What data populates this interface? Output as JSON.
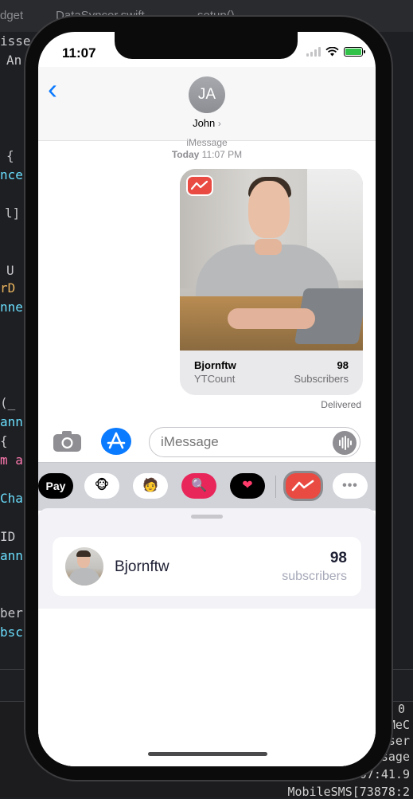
{
  "background": {
    "top_breadcrumb": [
      "dget",
      "DataSyncer.swift",
      "setup()"
    ],
    "code_fragments": [
      "isse",
      "An",
      "{",
      "nce",
      "l]",
      "U",
      "rD",
      "nne",
      "(_",
      "ann",
      "{",
      "m a",
      "Cha",
      "ID",
      "ann",
      "ber",
      "bsc"
    ],
    "console_lines": [
      "0",
      "MeC",
      "ser",
      "sage",
      "07:41.9",
      "MobileSMS[73878:2"
    ]
  },
  "status_bar": {
    "time": "11:07"
  },
  "header": {
    "back_label": "‹",
    "avatar_initials": "JA",
    "contact_name": "John",
    "chevron": "›"
  },
  "conversation": {
    "service": "iMessage",
    "timestamp_day": "Today",
    "timestamp_time": "11:07 PM",
    "message_card": {
      "name": "Bjornftw",
      "app": "YTCount",
      "count": "98",
      "count_label": "Subscribers"
    },
    "delivered": "Delivered"
  },
  "composer": {
    "placeholder": "iMessage"
  },
  "app_drawer": {
    "items": [
      {
        "name": "apple-pay",
        "label": "Pay"
      },
      {
        "name": "animoji",
        "label": "🐵"
      },
      {
        "name": "memoji",
        "label": "🧑"
      },
      {
        "name": "web-search",
        "label": "🔍"
      },
      {
        "name": "digital-touch",
        "label": "❤"
      },
      {
        "name": "ytcount",
        "label": ""
      },
      {
        "name": "more",
        "label": "•••"
      }
    ]
  },
  "extension": {
    "name": "Bjornftw",
    "count": "98",
    "count_label": "subscribers"
  },
  "colors": {
    "accent": "#0a7aff",
    "app_red": "#e94b43",
    "battery": "#32c24a"
  }
}
